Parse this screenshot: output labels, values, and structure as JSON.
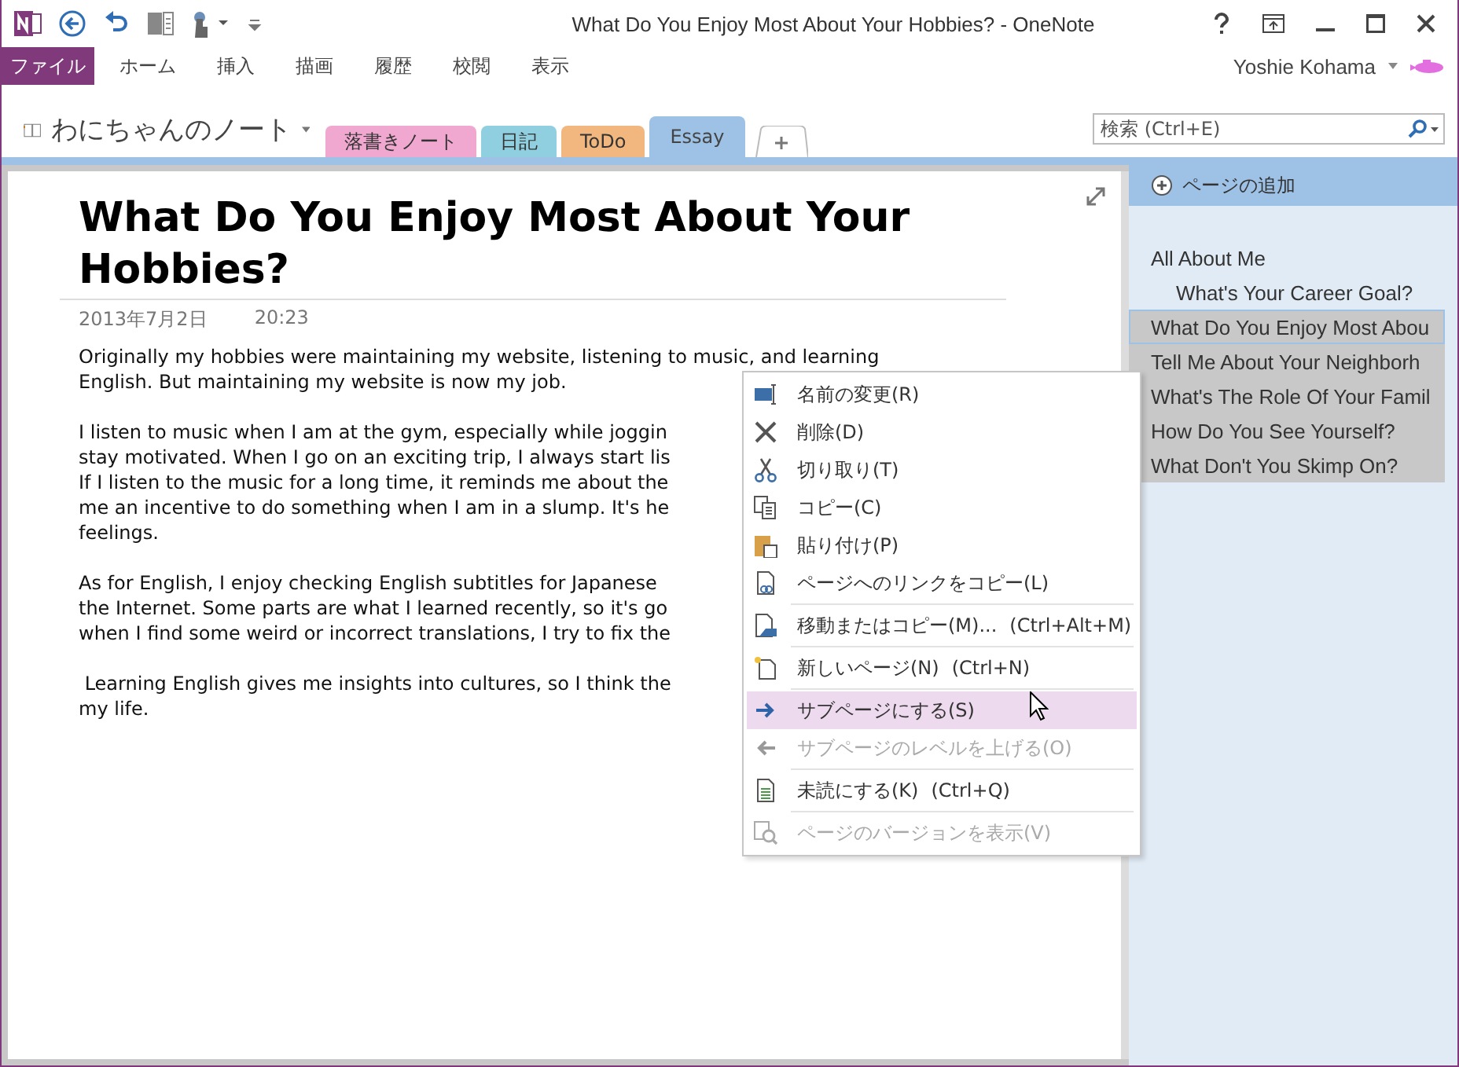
{
  "title_bar": {
    "title": "What Do You Enjoy Most About Your Hobbies? - OneNote"
  },
  "ribbon": {
    "tabs": [
      {
        "label": "ファイル",
        "kind": "file"
      },
      {
        "label": "ホーム",
        "kind": "tab"
      },
      {
        "label": "挿入",
        "kind": "tab"
      },
      {
        "label": "描画",
        "kind": "tab"
      },
      {
        "label": "履歴",
        "kind": "tab"
      },
      {
        "label": "校閲",
        "kind": "tab"
      },
      {
        "label": "表示",
        "kind": "tab"
      }
    ],
    "user": "Yoshie Kohama"
  },
  "notebook": {
    "name": "わにちゃんのノート",
    "sections": [
      {
        "label": "落書きノート",
        "color": "#f0a8d0",
        "selected": false
      },
      {
        "label": "日記",
        "color": "#8fcfdf",
        "selected": false
      },
      {
        "label": "ToDo",
        "color": "#f2b77e",
        "selected": false
      },
      {
        "label": "Essay",
        "color": "#9ec1e6",
        "selected": true
      }
    ],
    "search": {
      "placeholder": "検索 (Ctrl+E)"
    }
  },
  "page": {
    "title": "What Do You Enjoy Most About Your Hobbies?",
    "date": "2013年7月2日",
    "time": "20:23",
    "paragraphs": [
      [
        "Originally my hobbies were maintaining my website, listening to music, and learning",
        "English. But maintaining my website is now my job."
      ],
      [
        "I listen to music when I am at the gym, especially while joggin",
        "stay motivated. When I go on an exciting trip, I always start lis",
        "If I listen to the music for a long time, it reminds me about the",
        "me an incentive to do something when I am in a slump. It's he",
        "feelings."
      ],
      [
        "As for English, I enjoy checking English subtitles for Japanese",
        "the Internet. Some parts are what I learned recently, so it's go",
        "when I find some weird or incorrect translations, I try to fix the"
      ],
      [
        " Learning English gives me insights into cultures, so I think the",
        "my life."
      ]
    ]
  },
  "page_list": {
    "add_page": "ページの追加",
    "pages": [
      {
        "title": "All About Me",
        "selected": false,
        "current": false,
        "children": [
          {
            "title": "What's Your Career Goal?",
            "selected": false,
            "current": false
          }
        ]
      },
      {
        "title": "What Do You Enjoy Most Abou",
        "selected": true,
        "current": true
      },
      {
        "title": "Tell Me About Your Neighborh",
        "selected": true,
        "current": false
      },
      {
        "title": "What's The Role Of Your Famil",
        "selected": true,
        "current": false
      },
      {
        "title": "How Do You See Yourself?",
        "selected": true,
        "current": false
      },
      {
        "title": "What Don't You Skimp On?",
        "selected": true,
        "current": false
      }
    ]
  },
  "context_menu": {
    "items": [
      {
        "kind": "rename",
        "label": "名前の変更(R)",
        "disabled": false,
        "hovered": false,
        "separator_before": false
      },
      {
        "kind": "delete",
        "label": "削除(D)",
        "disabled": false,
        "hovered": false,
        "separator_before": false
      },
      {
        "kind": "cut",
        "label": "切り取り(T)",
        "disabled": false,
        "hovered": false,
        "separator_before": false
      },
      {
        "kind": "copy",
        "label": "コピー(C)",
        "disabled": false,
        "hovered": false,
        "separator_before": false
      },
      {
        "kind": "paste",
        "label": "貼り付け(P)",
        "disabled": false,
        "hovered": false,
        "separator_before": false
      },
      {
        "kind": "link",
        "label": "ページへのリンクをコピー(L)",
        "disabled": false,
        "hovered": false,
        "separator_before": false
      },
      {
        "kind": "move",
        "label": "移動またはコピー(M)...",
        "shortcut": "(Ctrl+Alt+M)",
        "disabled": false,
        "hovered": false,
        "separator_before": true
      },
      {
        "kind": "new",
        "label": "新しいページ(N)",
        "shortcut": "(Ctrl+N)",
        "disabled": false,
        "hovered": false,
        "separator_before": true
      },
      {
        "kind": "indent",
        "label": "サブページにする(S)",
        "disabled": false,
        "hovered": true,
        "separator_before": true
      },
      {
        "kind": "outdent",
        "label": "サブページのレベルを上げる(O)",
        "disabled": true,
        "hovered": false,
        "separator_before": false
      },
      {
        "kind": "unread",
        "label": "未読にする(K)",
        "shortcut": "(Ctrl+Q)",
        "disabled": false,
        "hovered": false,
        "separator_before": true
      },
      {
        "kind": "versions",
        "label": "ページのバージョンを表示(V)",
        "disabled": true,
        "hovered": false,
        "separator_before": true
      }
    ]
  }
}
